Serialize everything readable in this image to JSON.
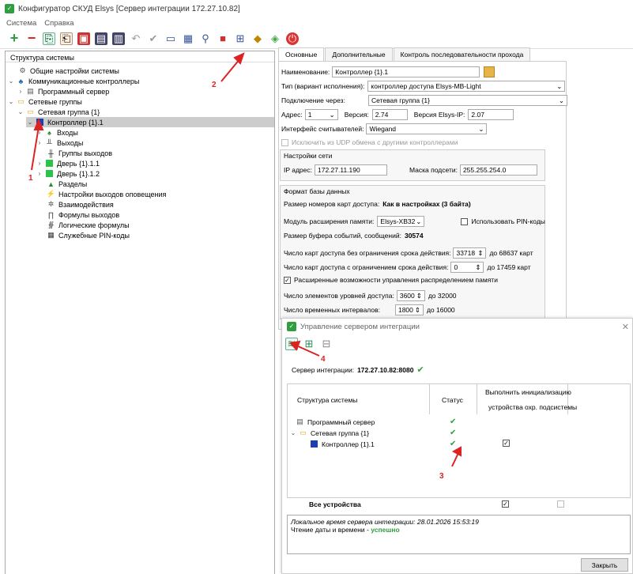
{
  "window": {
    "title": "Конфигуратор СКУД Elsys [Сервер интеграции 172.27.10.82]"
  },
  "menu": [
    "Система",
    "Справка"
  ],
  "tree": {
    "header": "Структура системы",
    "items": [
      {
        "label": "Общие настройки системы",
        "icon": "gear-icon"
      },
      {
        "label": "Коммуникационные контроллеры",
        "icon": "network-icon"
      },
      {
        "label": "Программный сервер",
        "icon": "server-icon"
      },
      {
        "label": "Сетевые группы",
        "icon": "folder-icon"
      },
      {
        "label": "Сетевая группа {1}",
        "icon": "folder-icon"
      },
      {
        "label": "Контроллер {1}.1",
        "icon": "controller-icon"
      },
      {
        "label": "Входы",
        "icon": "input-icon"
      },
      {
        "label": "Выходы",
        "icon": "output-icon"
      },
      {
        "label": "Группы выходов",
        "icon": "output-group-icon"
      },
      {
        "label": "Дверь {1}.1.1",
        "icon": "door-icon"
      },
      {
        "label": "Дверь {1}.1.2",
        "icon": "door-icon"
      },
      {
        "label": "Разделы",
        "icon": "sections-icon"
      },
      {
        "label": "Настройки выходов оповещения",
        "icon": "alarm-icon"
      },
      {
        "label": "Взаимодействия",
        "icon": "interaction-icon"
      },
      {
        "label": "Формулы выходов",
        "icon": "formula-icon"
      },
      {
        "label": "Логические формулы",
        "icon": "logic-icon"
      },
      {
        "label": "Служебные PIN-коды",
        "icon": "pin-icon"
      }
    ]
  },
  "tabs": [
    "Основные",
    "Дополнительные",
    "Контроль последовательности прохода"
  ],
  "props": {
    "name_label": "Наименование:",
    "name_value": "Контроллер {1}.1",
    "type_label": "Тип (вариант исполнения):",
    "type_value": "контроллер доступа Elsys-MB-Light",
    "conn_label": "Подключение через:",
    "conn_value": "Сетевая группа {1}",
    "addr_label": "Адрес:",
    "addr_value": "1",
    "ver_label": "Версия:",
    "ver_value": "2.74",
    "ip_ver_label": "Версия Elsys-IP:",
    "ip_ver_value": "2.07",
    "reader_label": "Интерфейс считывателей:",
    "reader_value": "Wiegand",
    "udp_label": "Исключить из UDP обмена с другими контроллерами",
    "net_title": "Настройки сети",
    "ip_label": "IP адрес:",
    "ip_value": "172.27.11.190",
    "mask_label": "Маска подсети:",
    "mask_value": "255.255.254.0",
    "db_title": "Формат базы данных",
    "card_size_label": "Размер номеров карт доступа:",
    "card_size_value": "Как в настройках (3 байта)",
    "mem_label": "Модуль расширения памяти:",
    "mem_value": "Elsys-XB32",
    "pin_label": "Использовать PIN-коды",
    "buf_label": "Размер буфера событий, сообщений:",
    "buf_value": "30574",
    "cards_unl_label": "Число карт доступа без ограничения срока действия:",
    "cards_unl_value": "33718",
    "cards_unl_max": "до 68637 карт",
    "cards_lim_label": "Число карт доступа с ограничением срока действия:",
    "cards_lim_value": "0",
    "cards_lim_max": "до 17459 карт",
    "ext_label": "Расширенные возможности управления распределением памяти",
    "levels_label": "Число элементов уровней доступа:",
    "levels_value": "3600",
    "levels_max": "до 32000",
    "intervals_label": "Число временных интервалов:",
    "intervals_value": "1800",
    "intervals_max": "до 16000"
  },
  "dialog": {
    "title": "Управление сервером интеграции",
    "server_label": "Сервер интеграции:",
    "server_value": "172.27.10.82:8080",
    "col_struct": "Структура системы",
    "col_status": "Статус",
    "col_init": "Выполнить инициализацию",
    "col_devices": "устройства",
    "col_subsys": "охр. подсистемы",
    "rows": [
      {
        "label": "Программный сервер"
      },
      {
        "label": "Сетевая группа {1}"
      },
      {
        "label": "Контроллер {1}.1"
      }
    ],
    "all_devices": "Все устройства",
    "log_line1": "Локальное время сервера интеграции: 28.01.2026 15:53:19",
    "log_line2_prefix": "Чтение даты и времени - ",
    "log_line2_status": "успешно",
    "close": "Закрыть"
  },
  "annotations": [
    "1",
    "2",
    "3",
    "4"
  ]
}
